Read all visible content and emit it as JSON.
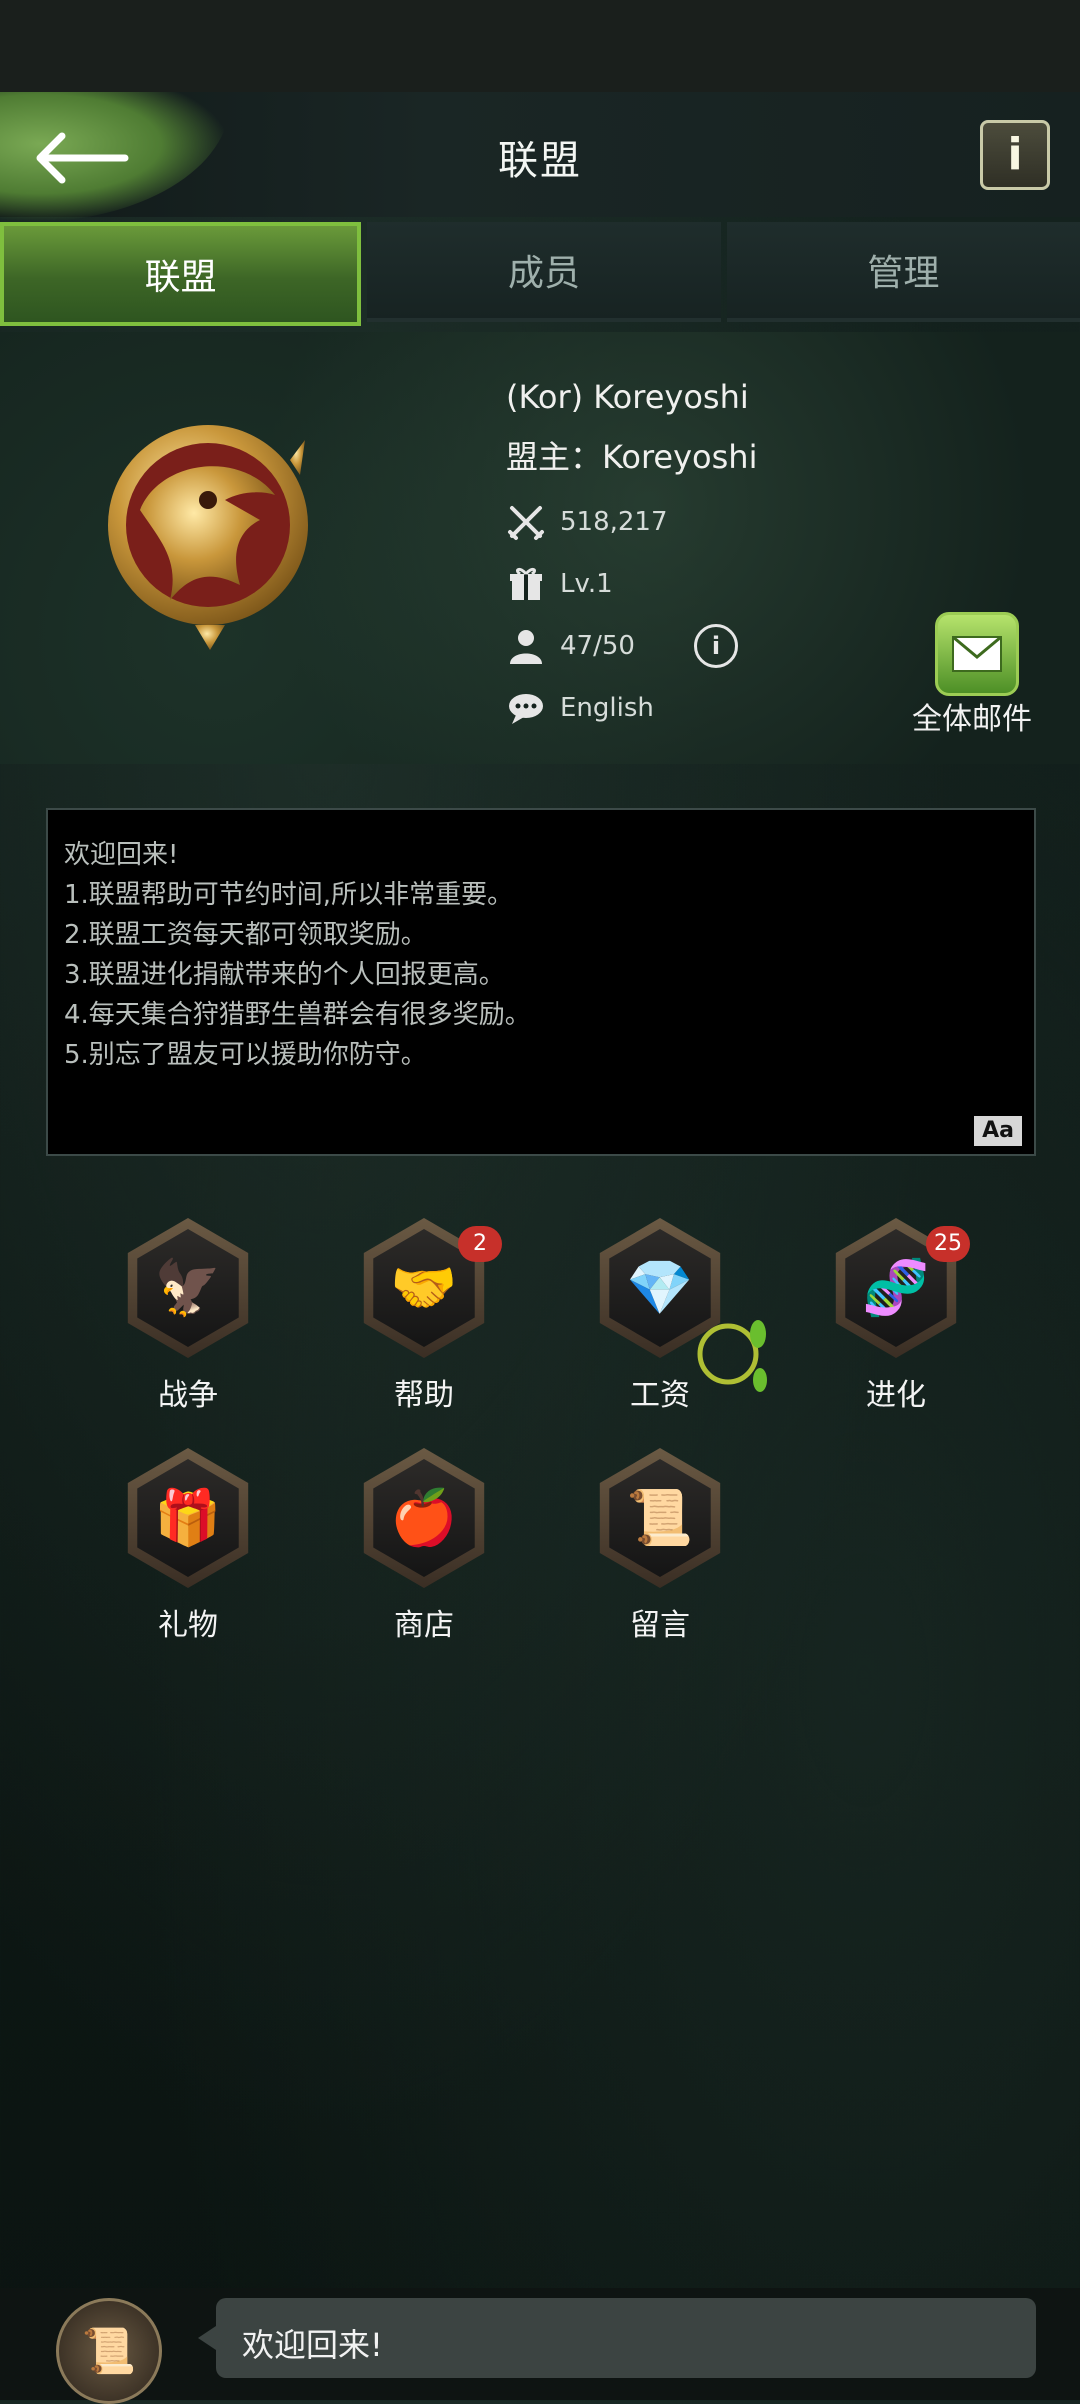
{
  "header": {
    "title": "联盟",
    "back_icon": "arrow-left-icon",
    "info_label": "i"
  },
  "tabs": [
    {
      "label": "联盟",
      "active": true
    },
    {
      "label": "成员",
      "active": false
    },
    {
      "label": "管理",
      "active": false
    }
  ],
  "profile": {
    "name": "(Kor) Koreyoshi",
    "leader": "盟主：Koreyoshi",
    "power": "518,217",
    "level": "Lv.1",
    "members": "47/50",
    "language": "English",
    "info_label": "i",
    "mail_label": "全体邮件"
  },
  "notice": {
    "lines": [
      "欢迎回来!",
      "1.联盟帮助可节约时间,所以非常重要。",
      "2.联盟工资每天都可领取奖励。",
      "3.联盟进化捐献带来的个人回报更高。",
      "4.每天集合狩猎野生兽群会有很多奖励。",
      "5.别忘了盟友可以援助你防守。"
    ],
    "translate_label": "Aa"
  },
  "grid": [
    {
      "label": "战争",
      "icon": "claw-icon",
      "badge": null
    },
    {
      "label": "帮助",
      "icon": "handshake-icon",
      "badge": "2"
    },
    {
      "label": "工资",
      "icon": "resources-icon",
      "badge": null
    },
    {
      "label": "进化",
      "icon": "dna-icon",
      "badge": "25"
    },
    {
      "label": "礼物",
      "icon": "gift-icon",
      "badge": null
    },
    {
      "label": "商店",
      "icon": "apples-icon",
      "badge": null
    },
    {
      "label": "留言",
      "icon": "notes-icon",
      "badge": null
    }
  ],
  "chat": {
    "message": "欢迎回来!",
    "avatar_icon": "notes-icon"
  },
  "colors": {
    "accent_green": "#7fbf3e",
    "badge_red": "#c7302a",
    "background": "#0f1a17"
  }
}
